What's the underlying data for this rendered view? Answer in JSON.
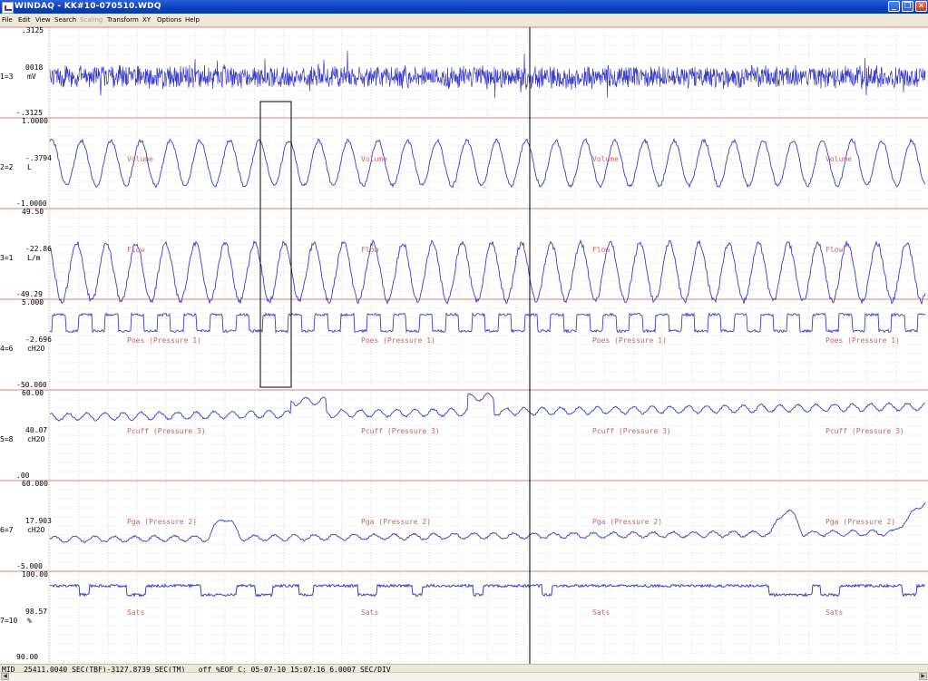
{
  "window": {
    "title": "WINDAQ - KK#10-070510.WDQ",
    "minimize_glyph": "_",
    "maximize_glyph": "❐",
    "close_glyph": "✕"
  },
  "menu": [
    {
      "label": "File",
      "disabled": false
    },
    {
      "label": "Edit",
      "disabled": false
    },
    {
      "label": "View",
      "disabled": false
    },
    {
      "label": "Search",
      "disabled": false
    },
    {
      "label": "Scaling",
      "disabled": true
    },
    {
      "label": "Transform",
      "disabled": false
    },
    {
      "label": "XY",
      "disabled": false
    },
    {
      "label": "Options",
      "disabled": false
    },
    {
      "label": "Help",
      "disabled": false
    }
  ],
  "channels": [
    {
      "id": "1=3",
      "top": ".3125",
      "mid": "0018",
      "bottom": "-.3125",
      "unit": "mV",
      "name": ""
    },
    {
      "id": "2=2",
      "top": "1.0000",
      "mid": "-.3794",
      "bottom": "-1.0000",
      "unit": "L",
      "name": "Volume"
    },
    {
      "id": "3=1",
      "top": "49.50",
      "mid": "-22.86",
      "bottom": "-49.29",
      "unit": "L/m",
      "name": "Flow"
    },
    {
      "id": "4=6",
      "top": "5.000",
      "mid": "-2.696",
      "bottom": "-50.000",
      "unit": "cH2O",
      "name": "Poes (Pressure 1)"
    },
    {
      "id": "5=8",
      "top": "60.00",
      "mid": "40.07",
      "bottom": ".00",
      "unit": "cH2O",
      "name": "Pcuff (Pressure 3)"
    },
    {
      "id": "6=7",
      "top": "60.000",
      "mid": "17.903",
      "bottom": "-5.000",
      "unit": "cH2O",
      "name": "Pga (Pressure 2)"
    },
    {
      "id": "7=10",
      "top": "100.00",
      "mid": "98.57",
      "bottom": "90.00",
      "unit": "%",
      "name": "Sats"
    }
  ],
  "status": {
    "text": "MID  25411.0040 SEC(TBF)-3127.8739 SEC(TM)   off %EOF C: 05-07-10 15:07:16 6.0007 SEC/DIV"
  },
  "colors": {
    "trace": "#3c3cc8",
    "grid_major": "#d98080",
    "grid_minor": "#c9c9c9",
    "channel_name": "#d06060",
    "title_bar": "#0a3fc0",
    "menu_bg": "#ece9d8"
  }
}
